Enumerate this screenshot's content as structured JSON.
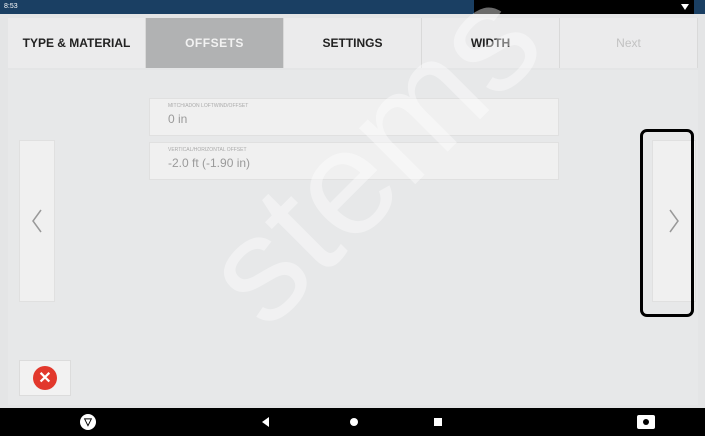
{
  "status_bar": {
    "time": "8:53"
  },
  "tabs": [
    {
      "label": "TYPE & MATERIAL",
      "state": "normal"
    },
    {
      "label": "OFFSETS",
      "state": "active"
    },
    {
      "label": "SETTINGS",
      "state": "normal"
    },
    {
      "label": "WIDTH",
      "state": "normal"
    },
    {
      "label": "Next",
      "state": "disabled"
    }
  ],
  "fields": [
    {
      "label": "MITCH/ADON LOFTWIND/OFFSET",
      "value": "0 in"
    },
    {
      "label": "VERTICAL/HORIZONTAL OFFSET",
      "value": "-2.0 ft (-1.90 in)"
    }
  ],
  "nav_arrows": {
    "left": "‹",
    "right": "›"
  },
  "cancel_glyph": "✕",
  "watermark": "stems",
  "colors": {
    "status_bar": "#1a3f63",
    "active_tab": "#b1b2b3",
    "cancel_red": "#e2382c",
    "highlight_border": "#000000"
  },
  "nav_bar": {
    "icons": [
      "app-logo-icon",
      "back-icon",
      "home-icon",
      "recents-icon",
      "camera-icon"
    ],
    "logo_glyph": "▽"
  }
}
